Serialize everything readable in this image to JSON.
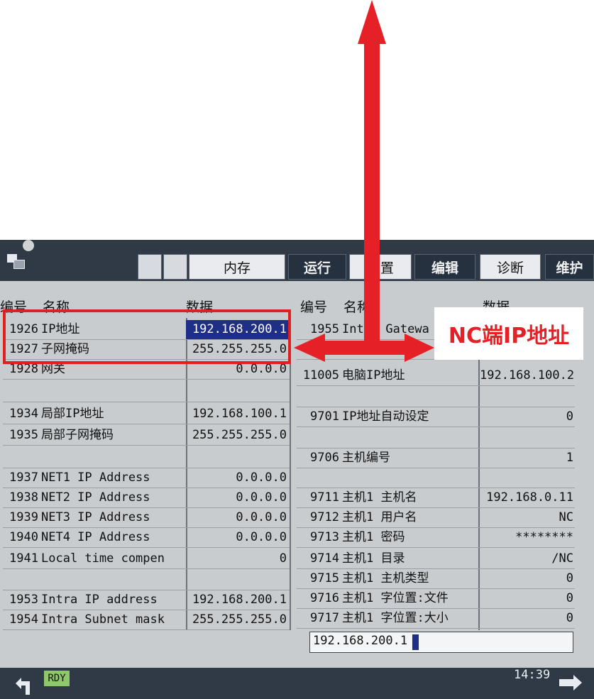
{
  "annotation": {
    "label": "NC端IP地址",
    "color": "#e52026"
  },
  "tabs": [
    {
      "label": "",
      "style": "blank"
    },
    {
      "label": "",
      "style": "blank"
    },
    {
      "label": "内存",
      "style": "light"
    },
    {
      "label": "运行",
      "style": "dark"
    },
    {
      "label": "设置",
      "style": "light"
    },
    {
      "label": "编辑",
      "style": "dark"
    },
    {
      "label": "诊断",
      "style": "light"
    },
    {
      "label": "维护",
      "style": "dark"
    }
  ],
  "left_headers": {
    "no": "编号",
    "name": "名称",
    "value": "数据"
  },
  "right_headers": {
    "no": "编号",
    "name": "名称",
    "value": "数据"
  },
  "left_rows": [
    {
      "no": "1926",
      "name": "IP地址",
      "value": "192.168.200.1",
      "selected": true
    },
    {
      "no": "1927",
      "name": "子网掩码",
      "value": "255.255.255.0"
    },
    {
      "no": "1928",
      "name": "网关",
      "value": "0.0.0.0"
    },
    {
      "no": "",
      "name": "",
      "value": ""
    },
    {
      "no": "1934",
      "name": "局部IP地址",
      "value": "192.168.100.1"
    },
    {
      "no": "1935",
      "name": "局部子网掩码",
      "value": "255.255.255.0"
    },
    {
      "no": "",
      "name": "",
      "value": ""
    },
    {
      "no": "1937",
      "name": "NET1 IP Address",
      "value": "0.0.0.0"
    },
    {
      "no": "1938",
      "name": "NET2 IP Address",
      "value": "0.0.0.0"
    },
    {
      "no": "1939",
      "name": "NET3 IP Address",
      "value": "0.0.0.0"
    },
    {
      "no": "1940",
      "name": "NET4 IP Address",
      "value": "0.0.0.0"
    },
    {
      "no": "1941",
      "name": "Local time compen",
      "value": "0"
    },
    {
      "no": "",
      "name": "",
      "value": ""
    },
    {
      "no": "1953",
      "name": "Intra IP address",
      "value": "192.168.200.1"
    },
    {
      "no": "1954",
      "name": "Intra Subnet mask",
      "value": "255.255.255.0"
    }
  ],
  "right_rows": [
    {
      "no": "1955",
      "name": "Intra Gatewa",
      "value": ""
    },
    {
      "no": "",
      "name": "",
      "value": ""
    },
    {
      "no": "11005",
      "name": "电脑IP地址",
      "value": "192.168.100.2"
    },
    {
      "no": "",
      "name": "",
      "value": ""
    },
    {
      "no": "9701",
      "name": "IP地址自动设定",
      "value": "0"
    },
    {
      "no": "",
      "name": "",
      "value": ""
    },
    {
      "no": "9706",
      "name": "主机编号",
      "value": "1"
    },
    {
      "no": "",
      "name": "",
      "value": ""
    },
    {
      "no": "9711",
      "name": "主机1 主机名",
      "value": "192.168.0.11"
    },
    {
      "no": "9712",
      "name": "主机1 用户名",
      "value": "NC"
    },
    {
      "no": "9713",
      "name": "主机1 密码",
      "value": "********"
    },
    {
      "no": "9714",
      "name": "主机1 目录",
      "value": "/NC"
    },
    {
      "no": "9715",
      "name": "主机1 主机类型",
      "value": "0"
    },
    {
      "no": "9716",
      "name": "主机1 字位置:文件",
      "value": "0"
    },
    {
      "no": "9717",
      "name": "主机1 字位置:大小",
      "value": "0"
    }
  ],
  "input": {
    "value": "192.168.200.1"
  },
  "status": {
    "rdy": "RDY",
    "time": "14:39"
  },
  "icons": {
    "back": "return-arrow-icon",
    "forward": "next-arrow-icon"
  }
}
